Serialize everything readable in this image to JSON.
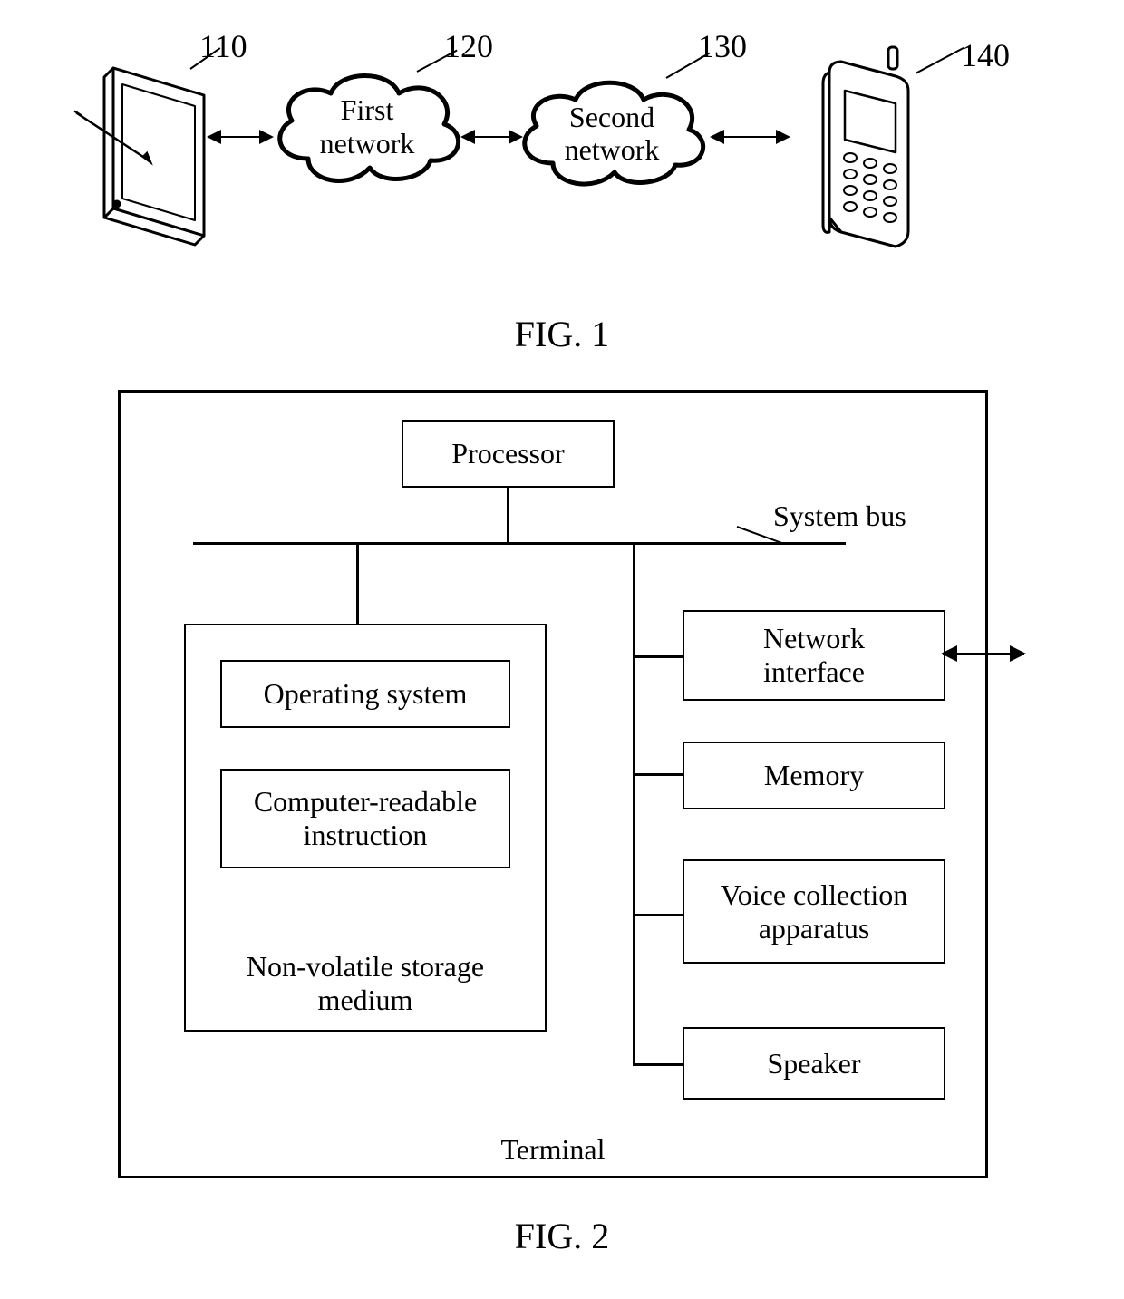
{
  "fig1": {
    "refs": {
      "tablet": "110",
      "cloud_first": "120",
      "cloud_second": "130",
      "phone": "140"
    },
    "cloud_first_label": "First\nnetwork",
    "cloud_second_label": "Second\nnetwork",
    "caption": "FIG. 1"
  },
  "fig2": {
    "caption": "FIG. 2",
    "outer_label": "Terminal",
    "processor": "Processor",
    "system_bus_label": "System bus",
    "storage": {
      "outer_label": "Non-volatile storage\nmedium",
      "os": "Operating system",
      "instr": "Computer-readable\ninstruction"
    },
    "right": {
      "net_if": "Network\ninterface",
      "memory": "Memory",
      "voice": "Voice collection\napparatus",
      "speaker": "Speaker"
    }
  }
}
